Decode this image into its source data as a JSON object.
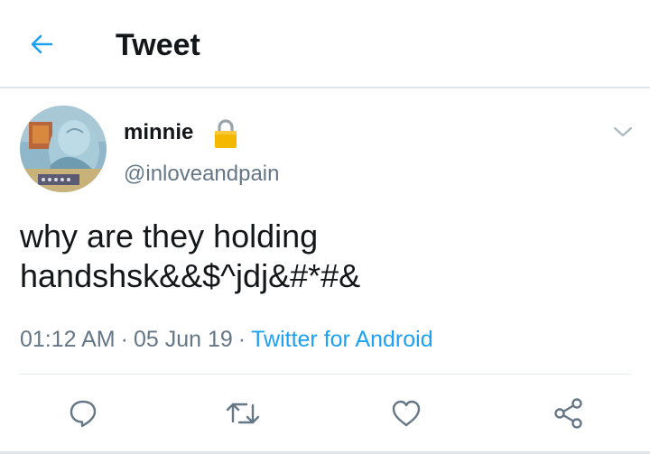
{
  "header": {
    "title": "Tweet",
    "back_icon": "arrow-left-icon"
  },
  "tweet": {
    "display_name": "minnie",
    "protected_icon": "lock-icon",
    "handle": "@inloveandpain",
    "text_lines": [
      "why are they holding",
      "handshsk&&$^jdj&#*#&"
    ],
    "time": "01:12 AM",
    "date": "05 Jun 19",
    "separator": "·",
    "source": "Twitter for Android",
    "menu_icon": "chevron-down-icon"
  },
  "actions": [
    {
      "icon": "reply-icon"
    },
    {
      "icon": "retweet-icon"
    },
    {
      "icon": "like-icon"
    },
    {
      "icon": "share-icon"
    }
  ],
  "colors": {
    "accent": "#1da1f2",
    "text": "#14171a",
    "secondary": "#657786",
    "divider": "#e1e8ed",
    "lock": "#f5b800"
  }
}
